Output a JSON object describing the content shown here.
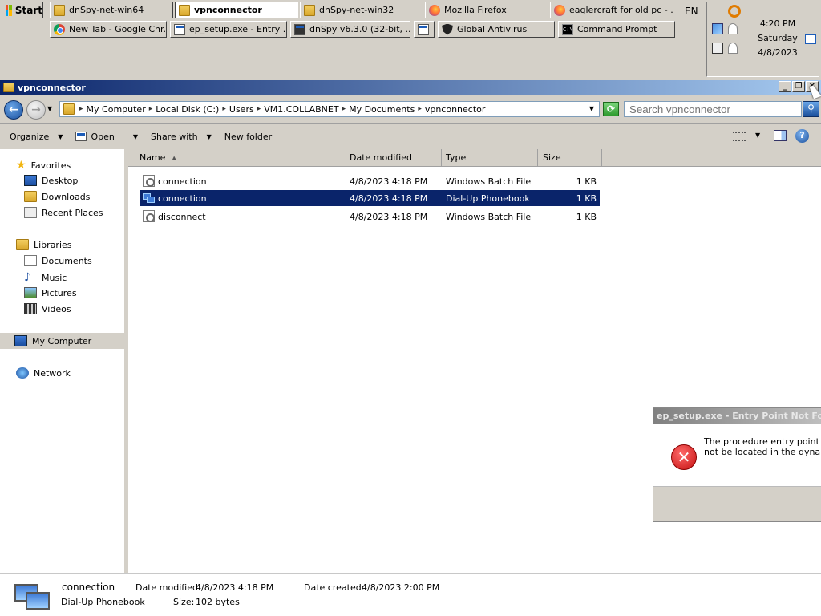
{
  "taskbar": {
    "start_label": "Start",
    "row1": [
      {
        "label": "dnSpy-net-win64",
        "icon": "folder-icon"
      },
      {
        "label": "vpnconnector",
        "icon": "folder-icon",
        "active": true
      },
      {
        "label": "dnSpy-net-win32",
        "icon": "folder-icon"
      },
      {
        "label": "Mozilla Firefox",
        "icon": "firefox-icon"
      },
      {
        "label": "eaglercraft for old pc - ...",
        "icon": "firefox-icon"
      }
    ],
    "row2": [
      {
        "label": "New Tab - Google Chr...",
        "icon": "chrome-icon"
      },
      {
        "label": "ep_setup.exe - Entry ...",
        "icon": "window-icon"
      },
      {
        "label": "dnSpy v6.3.0 (32-bit, ...",
        "icon": "dnspy-icon"
      },
      {
        "label": "",
        "icon": "window-icon"
      },
      {
        "label": "Global Antivirus",
        "icon": "shield-icon"
      },
      {
        "label": "Command Prompt",
        "icon": "cmd-icon"
      }
    ],
    "language": "EN",
    "clock": {
      "time": "4:20 PM",
      "day": "Saturday",
      "date": "4/8/2023"
    }
  },
  "window": {
    "title": "vpnconnector",
    "min_glyph": "_",
    "max_glyph": "❐",
    "close_glyph": "✕"
  },
  "address": {
    "crumbs": [
      "My Computer",
      "Local Disk (C:)",
      "Users",
      "VM1.COLLABNET",
      "My Documents",
      "vpnconnector"
    ],
    "search_placeholder": "Search vpnconnector"
  },
  "toolbar": {
    "organize": "Organize",
    "open": "Open",
    "share_with": "Share with",
    "new_folder": "New folder"
  },
  "nav": {
    "favorites": "Favorites",
    "desktop": "Desktop",
    "downloads": "Downloads",
    "recent_places": "Recent Places",
    "libraries": "Libraries",
    "documents": "Documents",
    "music": "Music",
    "pictures": "Pictures",
    "videos": "Videos",
    "my_computer": "My Computer",
    "network": "Network"
  },
  "columns": {
    "name": "Name",
    "date_modified": "Date modified",
    "type": "Type",
    "size": "Size"
  },
  "files": [
    {
      "name": "connection",
      "date": "4/8/2023 4:18 PM",
      "type": "Windows Batch File",
      "size": "1 KB",
      "selected": false
    },
    {
      "name": "connection",
      "date": "4/8/2023 4:18 PM",
      "type": "Dial-Up Phonebook",
      "size": "1 KB",
      "selected": true
    },
    {
      "name": "disconnect",
      "date": "4/8/2023 4:18 PM",
      "type": "Windows Batch File",
      "size": "1 KB",
      "selected": false
    }
  ],
  "details": {
    "name": "connection",
    "type": "Dial-Up Phonebook",
    "modified_label": "Date modified:",
    "modified_value": "4/8/2023 4:18 PM",
    "size_label": "Size:",
    "size_value": "102 bytes",
    "created_label": "Date created:",
    "created_value": "4/8/2023 2:00 PM"
  },
  "dialog": {
    "title": "ep_setup.exe - Entry Point Not Found",
    "line1": "The procedure entry point Set",
    "line2": "not be located in the dynamic l"
  },
  "colors": {
    "selection": "#0a246a",
    "titlebar_start": "#0a246a",
    "titlebar_end": "#a6caf0"
  }
}
